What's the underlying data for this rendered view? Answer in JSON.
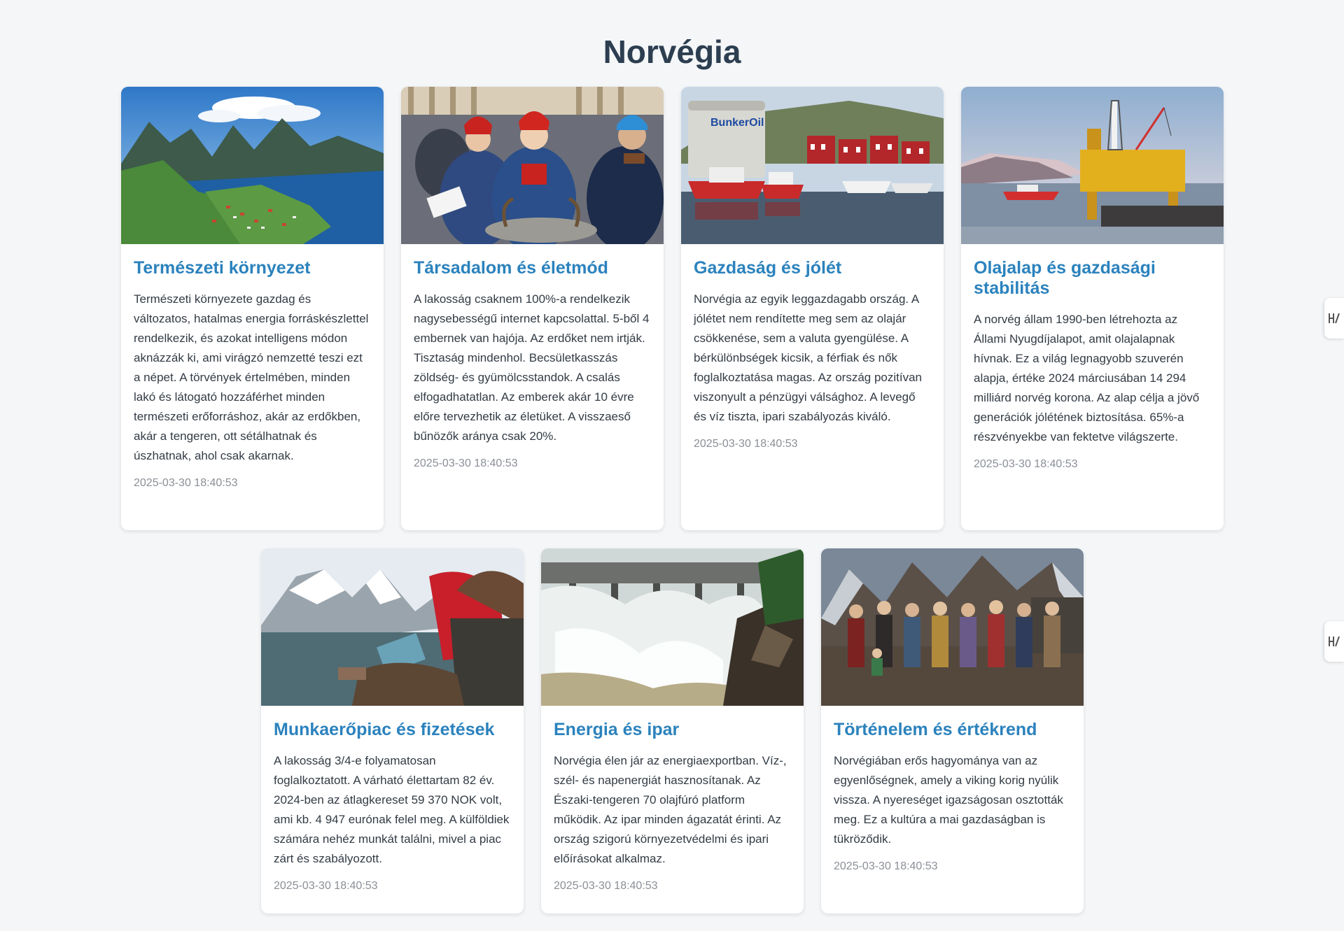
{
  "page": {
    "title": "Norvégia"
  },
  "cards": [
    {
      "title": "Természeti környezet",
      "text": "Természeti környezete gazdag és változatos, hatalmas energia forráskészlettel rendelkezik, és azokat intelligens módon aknázzák ki, ami virágzó nemzetté teszi ezt a népet. A törvények értelmében, minden lakó és látogató hozzáférhet minden természeti erőforráshoz, akár az erdőkben, akár a tengeren, ott sétálhatnak és úszhatnak, ahol csak akarnak.",
      "date": "2025-03-30 18:40:53",
      "image": "fjord-landscape-image"
    },
    {
      "title": "Társadalom és életmód",
      "text": "A lakosság csaknem 100%-a rendelkezik nagysebességű internet kapcsolattal. 5-ből 4 embernek van hajója. Az erdőket nem irtják. Tisztaság mindenhol. Becsületkasszás zöldség- és gyümölcsstandok. A csalás elfogadhatatlan. Az emberek akár 10 évre előre tervezhetik az életüket. A visszaeső bűnözők aránya csak 20%.",
      "date": "2025-03-30 18:40:53",
      "image": "sami-people-crowd-image"
    },
    {
      "title": "Gazdaság és jólét",
      "text": "Norvégia az egyik leggazdagabb ország. A jólétet nem rendítette meg sem az olajár csökkenése, sem a valuta gyengülése. A bérkülönbségek kicsik, a férfiak és nők foglalkoztatása magas. Az ország pozitívan viszonyult a pénzügyi válsághoz. A levegő és víz tiszta, ipari szabályozás kiváló.",
      "date": "2025-03-30 18:40:53",
      "image": "harbor-boats-image",
      "image_sign": "BunkerOil"
    },
    {
      "title": "Olajalap és gazdasági stabilitás",
      "text": "A norvég állam 1990-ben létrehozta az Állami Nyugdíjalapot, amit olajalapnak hívnak. Ez a világ legnagyobb szuverén alapja, értéke 2024 márciusában 14 294 milliárd norvég korona. Az alap célja a jövő generációk jólétének biztosítása. 65%-a részvényekbe van fektetve világszerte.",
      "date": "2025-03-30 18:40:53",
      "image": "oil-platform-image"
    },
    {
      "title": "Munkaerőpiac és fizetések",
      "text": "A lakosság 3/4-e folyamatosan foglalkoztatott. A várható élettartam 82 év. 2024-ben az átlagkereset 59 370 NOK volt, ami kb. 4 947 eurónak felel meg. A külföldiek számára nehéz munkát találni, mivel a piac zárt és szabályozott.",
      "date": "2025-03-30 18:40:53",
      "image": "laptop-mountains-image"
    },
    {
      "title": "Energia és ipar",
      "text": "Norvégia élen jár az energiaexportban. Víz-, szél- és napenergiát hasznosítanak. Az Északi-tengeren 70 olajfúró platform működik. Az ipar minden ágazatát érinti. Az ország szigorú környezetvédelmi és ipari előírásokat alkalmaz.",
      "date": "2025-03-30 18:40:53",
      "image": "hydro-dam-image"
    },
    {
      "title": "Történelem és értékrend",
      "text": "Norvégiában erős hagyománya van az egyenlőségnek, amely a viking korig nyúlik vissza. A nyereséget igazságosan osztották meg. Ez a kultúra a mai gazdaságban is tükröződik.",
      "date": "2025-03-30 18:40:53",
      "image": "viking-group-image"
    }
  ],
  "side_tabs": [
    {
      "icon": "translate-icon"
    },
    {
      "icon": "translate-icon"
    }
  ]
}
